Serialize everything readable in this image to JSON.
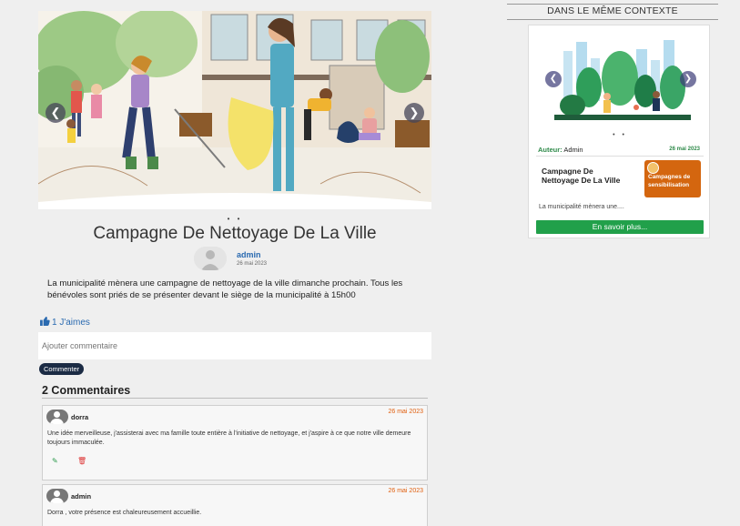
{
  "post": {
    "title": "Campagne De Nettoyage De La Ville",
    "author": "admin",
    "date": "26 mai 2023",
    "body": "La municipalité mènera une campagne de nettoyage de la ville dimanche prochain. Tous les bénévoles sont priés de se présenter devant le siège de la municipalité à 15h00",
    "likes_label": "1 J'aimes",
    "carousel_dots": "• •"
  },
  "comment_form": {
    "placeholder": "Ajouter commentaire",
    "submit_label": "Commenter"
  },
  "comments": {
    "heading": "2 Commentaires",
    "items": [
      {
        "author": "dorra",
        "date": "26 mai 2023",
        "text": "Une idée merveilleuse, j'assisterai avec ma famille toute entière à l'initiative de nettoyage, et j'aspire à ce que notre ville demeure toujours immaculée.",
        "edit_icon": "edit-icon",
        "delete_icon": "trash-icon"
      },
      {
        "author": "admin",
        "date": "26 mai 2023",
        "text": "Dorra , votre présence est chaleureusement accueillie."
      }
    ]
  },
  "sidebar": {
    "heading": "DANS LE MÊME CONTEXTE",
    "card": {
      "author_label": "Auteur:",
      "author": "Admin",
      "date": "26 mai 2023",
      "title": "Campagne De Nettoyage De La Ville",
      "category": "Campagnes de sensibilisation",
      "excerpt": "La municipalité mènera une....",
      "button_label": "En savoir plus...",
      "dots": "• •"
    }
  },
  "colors": {
    "link_blue": "#2a6ab0",
    "button_dark": "#1b2b44",
    "accent_green": "#21a04a",
    "date_orange": "#e06010",
    "badge_orange": "#d4660f"
  }
}
